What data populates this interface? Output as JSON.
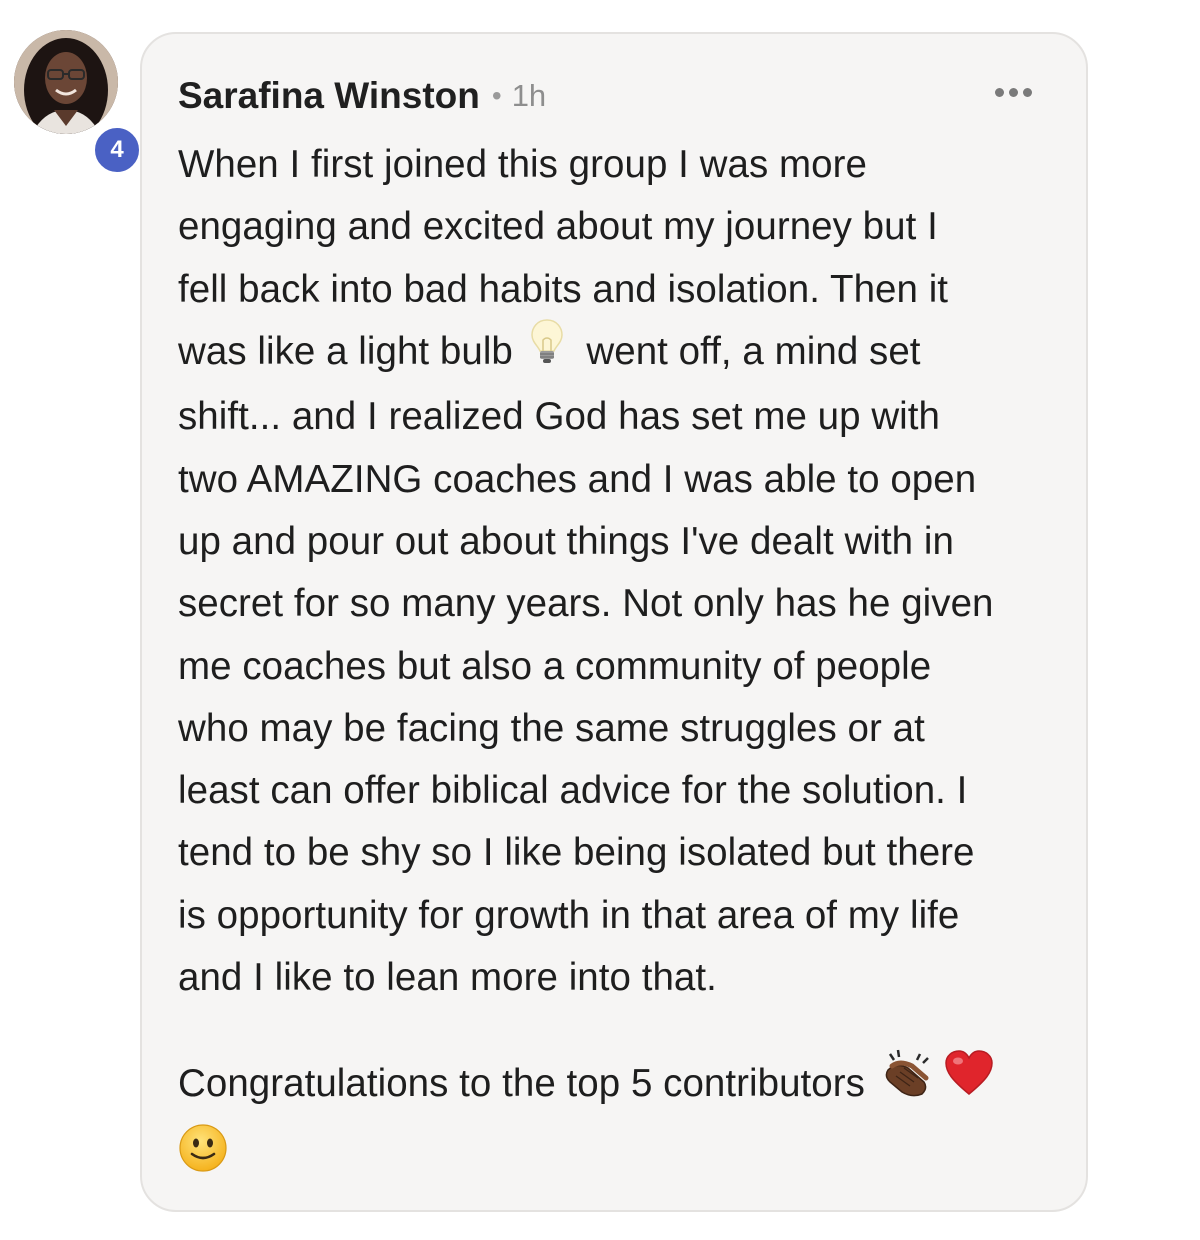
{
  "post": {
    "author": "Sarafina Winston",
    "separator": "•",
    "timestamp": "1h",
    "level_badge": "4",
    "more_icon": "more-horizontal-icon",
    "body": {
      "line_01": "When I first joined this group I was more",
      "line_02": "engaging and excited about my journey but I",
      "line_03": "fell back into bad habits and isolation. Then it",
      "line_04a": "was like a light bulb",
      "line_04b": "went off, a mind set",
      "line_05": "shift... and I realized God has set me up with",
      "line_06": "two AMAZING coaches and I was able to open",
      "line_07": "up and pour out about things I've dealt with in",
      "line_08": "secret for so many years. Not only has he given",
      "line_09": "me coaches but also a community of people",
      "line_10": "who may be facing the same struggles or at",
      "line_11": "least can offer biblical advice for the solution. I",
      "line_12": "tend to be shy so I like being isolated but there",
      "line_13": "is opportunity for growth in that area of my life",
      "line_14": "and I like to lean more into that.",
      "line_15": "Congratulations to the top 5 contributors"
    },
    "emojis": [
      "light-bulb",
      "clapping-hands-dark-skin",
      "red-heart",
      "slightly-smiling-face"
    ],
    "colors": {
      "badge": "#4a61c4",
      "bubble_bg": "#f6f5f4",
      "bubble_border": "#e4e2e0",
      "heart": "#e0252c",
      "smiley": "#f9c32d"
    }
  }
}
